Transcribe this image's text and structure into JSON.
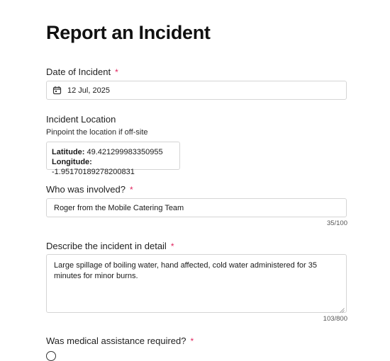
{
  "form": {
    "title": "Report an Incident",
    "required_marker": "*",
    "date": {
      "label": "Date of Incident",
      "value": "12 Jul, 2025"
    },
    "location": {
      "label": "Incident Location",
      "hint": "Pinpoint the location if off-site",
      "latitude_label": "Latitude:",
      "latitude_value": "49.421299983350955",
      "longitude_label": "Longitude:",
      "longitude_value": "-1.95170189278200831"
    },
    "involved": {
      "label": "Who was involved?",
      "value": "Roger from the Mobile Catering Team",
      "counter": "35/100"
    },
    "description": {
      "label": "Describe the incident in detail",
      "value": "Large spillage of boiling water, hand affected, cold water administered for 35 minutes for minor burns.",
      "counter": "103/800"
    },
    "medical": {
      "label": "Was medical assistance required?"
    }
  }
}
